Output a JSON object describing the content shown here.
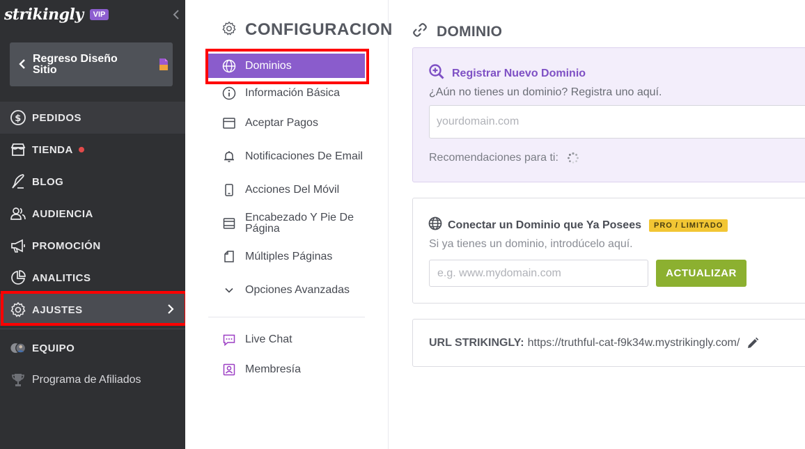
{
  "brand": {
    "logo_text": "strikingly",
    "vip_badge": "VIP"
  },
  "back_card": {
    "label": "Regreso Diseño Sitio"
  },
  "nav": {
    "items": [
      {
        "label": "PEDIDOS",
        "icon": "dollar-circle-icon"
      },
      {
        "label": "TIENDA",
        "icon": "store-icon"
      },
      {
        "label": "BLOG",
        "icon": "feather-pen-icon"
      },
      {
        "label": "AUDIENCIA",
        "icon": "users-icon"
      },
      {
        "label": "PROMOCIÓN",
        "icon": "megaphone-icon"
      },
      {
        "label": "ANALITICS",
        "icon": "pie-chart-icon"
      },
      {
        "label": "AJUSTES",
        "icon": "gear-icon"
      },
      {
        "label": "EQUIPO",
        "icon": "team-avatars-icon"
      },
      {
        "label": "Programa de Afiliados",
        "icon": "trophy-icon"
      }
    ]
  },
  "settings": {
    "title": "CONFIGURACION",
    "items": [
      {
        "label": "Dominios",
        "icon": "globe-icon"
      },
      {
        "label": "Información Básica",
        "icon": "info-icon"
      },
      {
        "label": "Aceptar Pagos",
        "icon": "card-icon"
      },
      {
        "label": "Notificaciones De Email",
        "icon": "bell-icon"
      },
      {
        "label": "Acciones Del Móvil",
        "icon": "mobile-icon"
      },
      {
        "label": "Encabezado Y Pie De Página",
        "icon": "layout-icon"
      },
      {
        "label": "Múltiples Páginas",
        "icon": "pages-icon"
      },
      {
        "label": "Opciones Avanzadas",
        "icon": "chevron-down-icon"
      },
      {
        "label": "Live Chat",
        "icon": "chat-icon"
      },
      {
        "label": "Membresía",
        "icon": "member-icon"
      }
    ]
  },
  "domain": {
    "title": "DOMINIO",
    "register": {
      "title": "Registrar Nuevo Dominio",
      "subtitle": "¿Aún no tienes un dominio? Registra uno aquí.",
      "placeholder": "yourdomain.com",
      "recommendations": "Recomendaciones para ti:"
    },
    "connect": {
      "title": "Conectar un Dominio que Ya Posees",
      "badge": "PRO / LIMITADO",
      "subtitle": "Si ya tienes un dominio, introdúcelo aquí.",
      "placeholder": "e.g. www.mydomain.com",
      "button": "ACTUALIZAR"
    },
    "url": {
      "label": "URL STRIKINGLY:",
      "value": "https://truthful-cat-f9k34w.mystrikingly.com/"
    }
  },
  "colors": {
    "sidebar_bg": "#2f3033",
    "accent_purple": "#8a5ccc",
    "update_green": "#8cb030",
    "badge_yellow": "#f2c634",
    "highlight_red": "#ff0000"
  }
}
